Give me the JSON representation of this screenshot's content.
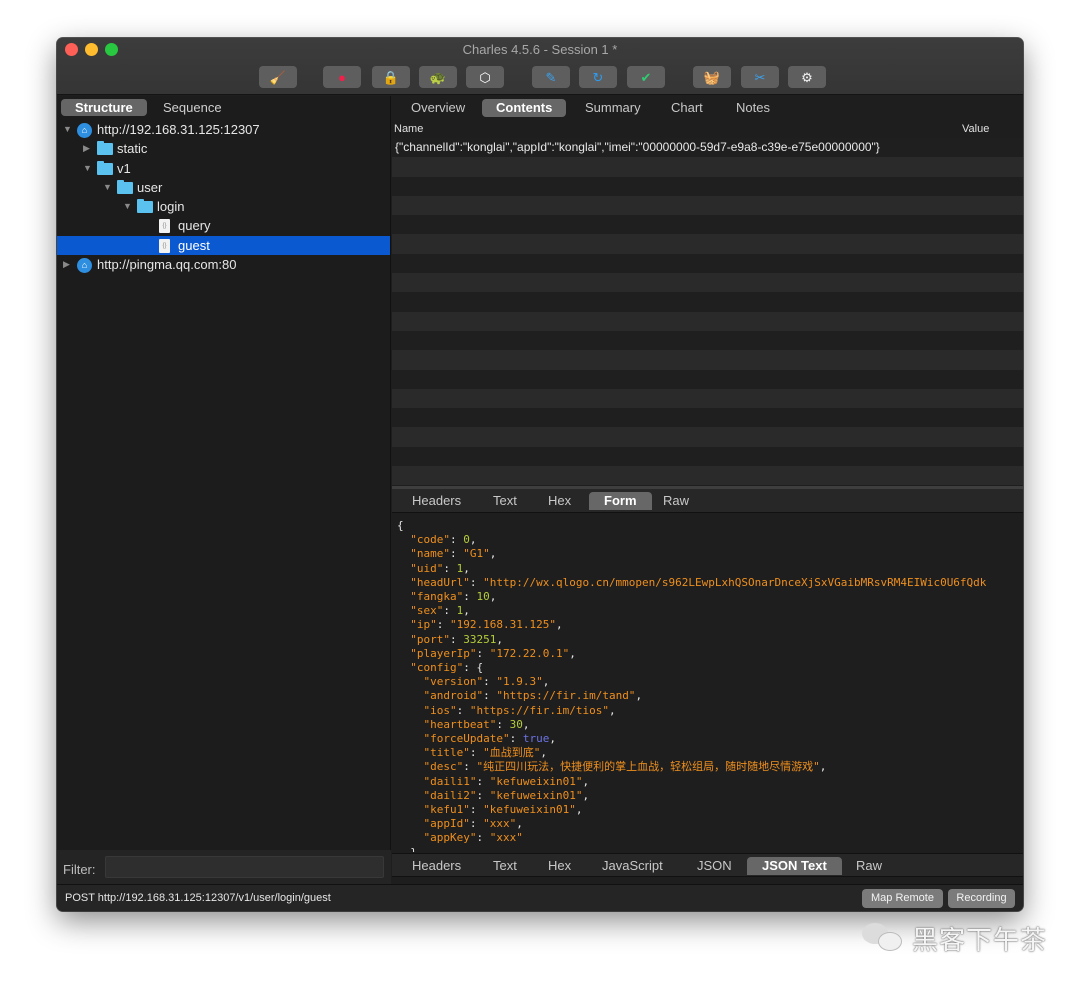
{
  "window": {
    "title": "Charles 4.5.6 - Session 1 *",
    "toolbar": [
      {
        "name": "broom-icon",
        "glyph": "🧹",
        "color": "#f4c20d"
      },
      {
        "name": "record-icon",
        "glyph": "●",
        "color": "#f0204a"
      },
      {
        "name": "ssl-lock-icon",
        "glyph": "🔒",
        "color": "#f2f2f2"
      },
      {
        "name": "throttle-turtle-icon",
        "glyph": "🐢",
        "color": "#cfcfcf"
      },
      {
        "name": "breakpoint-hexagon-icon",
        "glyph": "⬡",
        "color": "#ffffff"
      },
      {
        "name": "compose-pen-icon",
        "glyph": "✎",
        "color": "#3aa2f0"
      },
      {
        "name": "repeat-icon",
        "glyph": "↻",
        "color": "#2d9cf0"
      },
      {
        "name": "validate-check-icon",
        "glyph": "✔",
        "color": "#2ecc71"
      },
      {
        "name": "basket-icon",
        "glyph": "🧺",
        "color": "#2ecc71"
      },
      {
        "name": "tools-icon",
        "glyph": "✂",
        "color": "#3aa2f0"
      },
      {
        "name": "settings-gear-icon",
        "glyph": "⚙",
        "color": "#f2f2f2"
      }
    ]
  },
  "left": {
    "view_tabs": [
      "Structure",
      "Sequence"
    ],
    "active_view": "Structure",
    "tree": [
      {
        "label": "http://192.168.31.125:12307",
        "type": "host",
        "depth": 0,
        "expanded": true
      },
      {
        "label": "static",
        "type": "folder",
        "depth": 1,
        "expanded": false
      },
      {
        "label": "v1",
        "type": "folder",
        "depth": 1,
        "expanded": true
      },
      {
        "label": "user",
        "type": "folder",
        "depth": 2,
        "expanded": true
      },
      {
        "label": "login",
        "type": "folder",
        "depth": 3,
        "expanded": true
      },
      {
        "label": "query",
        "type": "file",
        "depth": 4
      },
      {
        "label": "guest",
        "type": "file",
        "depth": 4,
        "selected": true
      },
      {
        "label": "http://pingma.qq.com:80",
        "type": "host",
        "depth": 0,
        "expanded": false
      }
    ],
    "filter_label": "Filter:",
    "filter_value": ""
  },
  "right": {
    "tabs": [
      "Overview",
      "Contents",
      "Summary",
      "Chart",
      "Notes"
    ],
    "active_tab": "Contents",
    "columns": {
      "name": "Name",
      "value": "Value"
    },
    "request_rows": [
      "{\"channelId\":\"konglai\",\"appId\":\"konglai\",\"imei\":\"00000000-59d7-e9a8-c39e-e75e00000000\"}"
    ],
    "request_subtabs": [
      "Headers",
      "Text",
      "Hex",
      "Form",
      "Raw"
    ],
    "request_active_subtab": "Form",
    "response_subtabs": [
      "Headers",
      "Text",
      "Hex",
      "JavaScript",
      "JSON",
      "JSON Text",
      "Raw"
    ],
    "response_active_subtab": "JSON Text",
    "json_lines": [
      [
        [
          "p",
          "{"
        ]
      ],
      [
        [
          "p",
          "  "
        ],
        [
          "k",
          "\"code\""
        ],
        [
          "p",
          ": "
        ],
        [
          "num",
          "0"
        ],
        [
          "p",
          ","
        ]
      ],
      [
        [
          "p",
          "  "
        ],
        [
          "k",
          "\"name\""
        ],
        [
          "p",
          ": "
        ],
        [
          "s",
          "\"G1\""
        ],
        [
          "p",
          ","
        ]
      ],
      [
        [
          "p",
          "  "
        ],
        [
          "k",
          "\"uid\""
        ],
        [
          "p",
          ": "
        ],
        [
          "num",
          "1"
        ],
        [
          "p",
          ","
        ]
      ],
      [
        [
          "p",
          "  "
        ],
        [
          "k",
          "\"headUrl\""
        ],
        [
          "p",
          ": "
        ],
        [
          "s",
          "\"http://wx.qlogo.cn/mmopen/s962LEwpLxhQSOnarDnceXjSxVGaibMRsvRM4EIWic0U6fQdk"
        ]
      ],
      [
        [
          "p",
          "  "
        ],
        [
          "k",
          "\"fangka\""
        ],
        [
          "p",
          ": "
        ],
        [
          "num",
          "10"
        ],
        [
          "p",
          ","
        ]
      ],
      [
        [
          "p",
          "  "
        ],
        [
          "k",
          "\"sex\""
        ],
        [
          "p",
          ": "
        ],
        [
          "num",
          "1"
        ],
        [
          "p",
          ","
        ]
      ],
      [
        [
          "p",
          "  "
        ],
        [
          "k",
          "\"ip\""
        ],
        [
          "p",
          ": "
        ],
        [
          "s",
          "\"192.168.31.125\""
        ],
        [
          "p",
          ","
        ]
      ],
      [
        [
          "p",
          "  "
        ],
        [
          "k",
          "\"port\""
        ],
        [
          "p",
          ": "
        ],
        [
          "num",
          "33251"
        ],
        [
          "p",
          ","
        ]
      ],
      [
        [
          "p",
          "  "
        ],
        [
          "k",
          "\"playerIp\""
        ],
        [
          "p",
          ": "
        ],
        [
          "s",
          "\"172.22.0.1\""
        ],
        [
          "p",
          ","
        ]
      ],
      [
        [
          "p",
          "  "
        ],
        [
          "k",
          "\"config\""
        ],
        [
          "p",
          ": {"
        ]
      ],
      [
        [
          "p",
          "    "
        ],
        [
          "k",
          "\"version\""
        ],
        [
          "p",
          ": "
        ],
        [
          "s",
          "\"1.9.3\""
        ],
        [
          "p",
          ","
        ]
      ],
      [
        [
          "p",
          "    "
        ],
        [
          "k",
          "\"android\""
        ],
        [
          "p",
          ": "
        ],
        [
          "s",
          "\"https://fir.im/tand\""
        ],
        [
          "p",
          ","
        ]
      ],
      [
        [
          "p",
          "    "
        ],
        [
          "k",
          "\"ios\""
        ],
        [
          "p",
          ": "
        ],
        [
          "s",
          "\"https://fir.im/tios\""
        ],
        [
          "p",
          ","
        ]
      ],
      [
        [
          "p",
          "    "
        ],
        [
          "k",
          "\"heartbeat\""
        ],
        [
          "p",
          ": "
        ],
        [
          "num",
          "30"
        ],
        [
          "p",
          ","
        ]
      ],
      [
        [
          "p",
          "    "
        ],
        [
          "k",
          "\"forceUpdate\""
        ],
        [
          "p",
          ": "
        ],
        [
          "bool",
          "true"
        ],
        [
          "p",
          ","
        ]
      ],
      [
        [
          "p",
          "    "
        ],
        [
          "k",
          "\"title\""
        ],
        [
          "p",
          ": "
        ],
        [
          "s",
          "\"血战到底\""
        ],
        [
          "p",
          ","
        ]
      ],
      [
        [
          "p",
          "    "
        ],
        [
          "k",
          "\"desc\""
        ],
        [
          "p",
          ": "
        ],
        [
          "s",
          "\"纯正四川玩法，快捷便利的掌上血战，轻松组局，随时随地尽情游戏\""
        ],
        [
          "p",
          ","
        ]
      ],
      [
        [
          "p",
          "    "
        ],
        [
          "k",
          "\"daili1\""
        ],
        [
          "p",
          ": "
        ],
        [
          "s",
          "\"kefuweixin01\""
        ],
        [
          "p",
          ","
        ]
      ],
      [
        [
          "p",
          "    "
        ],
        [
          "k",
          "\"daili2\""
        ],
        [
          "p",
          ": "
        ],
        [
          "s",
          "\"kefuweixin01\""
        ],
        [
          "p",
          ","
        ]
      ],
      [
        [
          "p",
          "    "
        ],
        [
          "k",
          "\"kefu1\""
        ],
        [
          "p",
          ": "
        ],
        [
          "s",
          "\"kefuweixin01\""
        ],
        [
          "p",
          ","
        ]
      ],
      [
        [
          "p",
          "    "
        ],
        [
          "k",
          "\"appId\""
        ],
        [
          "p",
          ": "
        ],
        [
          "s",
          "\"xxx\""
        ],
        [
          "p",
          ","
        ]
      ],
      [
        [
          "p",
          "    "
        ],
        [
          "k",
          "\"appKey\""
        ],
        [
          "p",
          ": "
        ],
        [
          "s",
          "\"xxx\""
        ]
      ],
      [
        [
          "p",
          "  }"
        ]
      ]
    ]
  },
  "statusbar": {
    "text": "POST http://192.168.31.125:12307/v1/user/login/guest",
    "buttons": [
      "Map Remote",
      "Recording"
    ]
  },
  "watermark": {
    "text": "黑客下午茶"
  }
}
